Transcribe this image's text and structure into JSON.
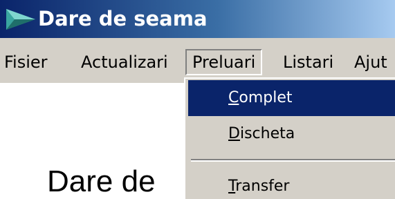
{
  "window": {
    "title": "Dare de seama",
    "icon": "app-play-icon"
  },
  "menubar": {
    "items": [
      {
        "label": "Fisier"
      },
      {
        "label": "Actualizari"
      },
      {
        "label": "Preluari",
        "open": true
      },
      {
        "label": "Listari"
      },
      {
        "label": "Ajut"
      }
    ]
  },
  "dropdown": {
    "items": [
      {
        "mnemonic": "C",
        "rest": "omplet",
        "selected": true
      },
      {
        "mnemonic": "D",
        "rest": "ischeta"
      },
      {
        "mnemonic": "T",
        "rest": "ransfer"
      }
    ]
  },
  "main": {
    "heading": "Dare de"
  },
  "colors": {
    "titlebar_start": "#0a246a",
    "titlebar_end": "#a6caf0",
    "menu_bg": "#d4d0c8",
    "selection_bg": "#0a246a"
  }
}
